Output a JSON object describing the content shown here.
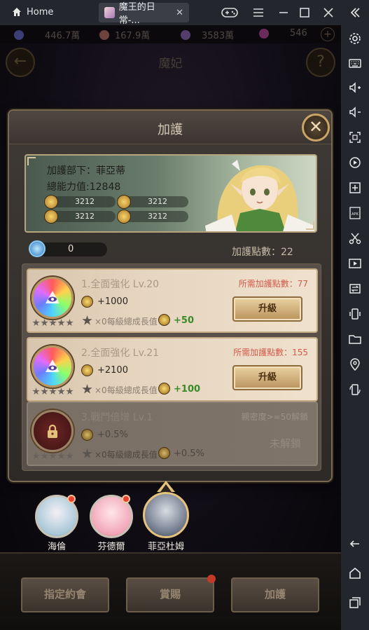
{
  "titlebar": {
    "home_label": "Home",
    "app_tab_label": "魔王的日常-...",
    "close_glyph": "✕"
  },
  "resources": [
    {
      "icon": "mana-crystal-icon",
      "value": "446.7萬",
      "color": "#6b6fd8"
    },
    {
      "icon": "meat-icon",
      "value": "167.9萬",
      "color": "#c77b6e"
    },
    {
      "icon": "demon-mask-icon",
      "value": "3583萬",
      "color": "#9c6fc4"
    },
    {
      "icon": "gem-icon",
      "value": "546",
      "color": "#c24fa5"
    }
  ],
  "background": {
    "screen_title": "魔妃"
  },
  "panel": {
    "title": "加護",
    "close_glyph": "✕",
    "banner": {
      "subordinate": "加護部下：菲亞蒂",
      "total_power": "總能力值:12848",
      "stats": [
        "3212",
        "3212",
        "3212",
        "3212"
      ]
    },
    "tokens": "0",
    "points": "加護點數：22",
    "cards": [
      {
        "name": "1.全面強化 Lv.20",
        "cost": "所需加護點數：77",
        "bonus": "+1000",
        "growth": "×0每級總成長值",
        "growth_value": "+50",
        "button": "升級",
        "locked": false
      },
      {
        "name": "2.全面強化 Lv.21",
        "cost": "所需加護點數：155",
        "bonus": "+2100",
        "growth": "×0每級總成長值",
        "growth_value": "+100",
        "button": "升級",
        "locked": false
      },
      {
        "name": "3.戰鬥倍增 Lv.1",
        "cost": "親密度>=50解鎖",
        "bonus": "+0.5%",
        "growth": "×0每級總成長值",
        "growth_value": "+0.5%",
        "status": "未解鎖",
        "locked": true
      }
    ]
  },
  "characters": [
    {
      "name": "海倫",
      "notification": true
    },
    {
      "name": "芬德爾",
      "notification": true
    },
    {
      "name": "菲亞杜姆",
      "notification": false,
      "selected": true
    }
  ],
  "bottom_buttons": [
    "指定約會",
    "賞賜",
    "加護"
  ],
  "colors": {
    "accent_gold": "#c9a566",
    "cost_red": "#d35a4a",
    "growth_green": "#3a8a2a",
    "badge_red": "#e9422e"
  }
}
